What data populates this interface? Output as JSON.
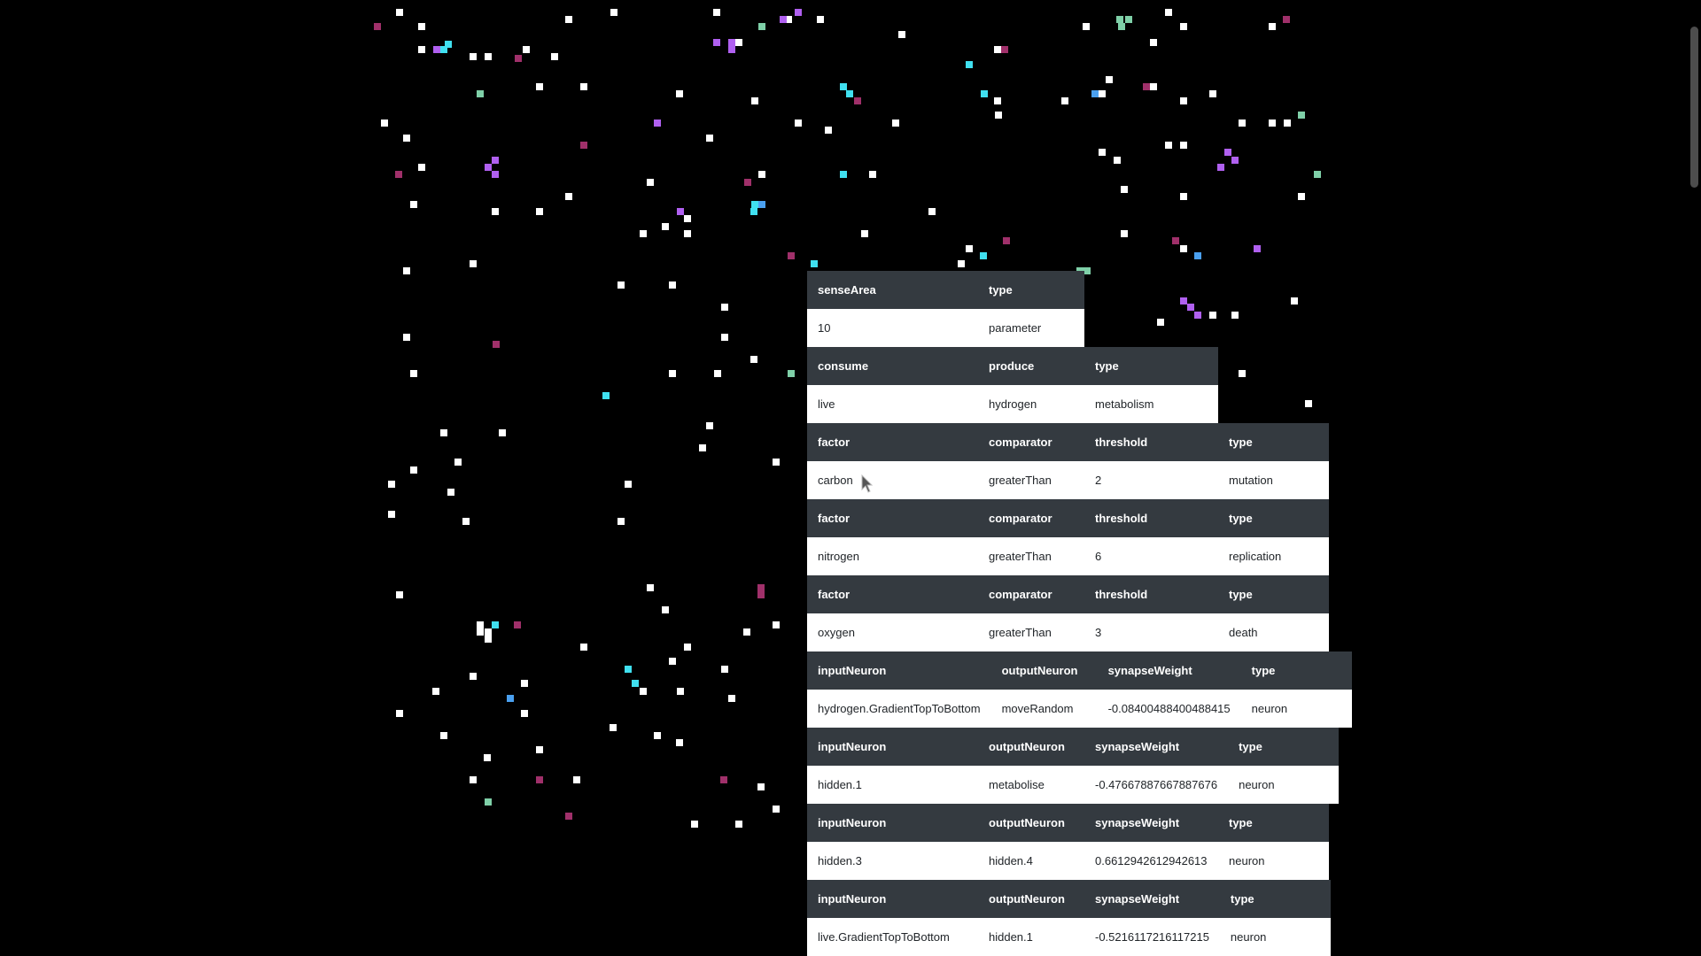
{
  "colors": {
    "background": "#000000",
    "header_bg": "#343a40",
    "cell_bg": "#ffffff",
    "particle_white": "#ffffff",
    "particle_cyan": "#40e0f0",
    "particle_purple": "#b060f0",
    "particle_magenta": "#a0306a",
    "particle_green": "#7fd0a8",
    "particle_blue": "#4aa0f0"
  },
  "tables": [
    {
      "headers": [
        "senseArea",
        "type"
      ],
      "row": [
        "10",
        "parameter"
      ]
    },
    {
      "headers": [
        "consume",
        "produce",
        "type"
      ],
      "row": [
        "live",
        "hydrogen",
        "metabolism"
      ]
    },
    {
      "headers": [
        "factor",
        "comparator",
        "threshold",
        "type"
      ],
      "row": [
        "carbon",
        "greaterThan",
        "2",
        "mutation"
      ]
    },
    {
      "headers": [
        "factor",
        "comparator",
        "threshold",
        "type"
      ],
      "row": [
        "nitrogen",
        "greaterThan",
        "6",
        "replication"
      ]
    },
    {
      "headers": [
        "factor",
        "comparator",
        "threshold",
        "type"
      ],
      "row": [
        "oxygen",
        "greaterThan",
        "3",
        "death"
      ]
    },
    {
      "headers": [
        "inputNeuron",
        "outputNeuron",
        "synapseWeight",
        "type"
      ],
      "row": [
        "hydrogen.GradientTopToBottom",
        "moveRandom",
        "-0.08400488400488415",
        "neuron"
      ]
    },
    {
      "headers": [
        "inputNeuron",
        "outputNeuron",
        "synapseWeight",
        "type"
      ],
      "row": [
        "hidden.1",
        "metabolise",
        "-0.47667887667887676",
        "neuron"
      ]
    },
    {
      "headers": [
        "inputNeuron",
        "outputNeuron",
        "synapseWeight",
        "type"
      ],
      "row": [
        "hidden.3",
        "hidden.4",
        "0.6612942612942613",
        "neuron"
      ]
    },
    {
      "headers": [
        "inputNeuron",
        "outputNeuron",
        "synapseWeight",
        "type"
      ],
      "row": [
        "live.GradientTopToBottom",
        "hidden.1",
        "-0.5216117216117215",
        "neuron"
      ]
    }
  ]
}
